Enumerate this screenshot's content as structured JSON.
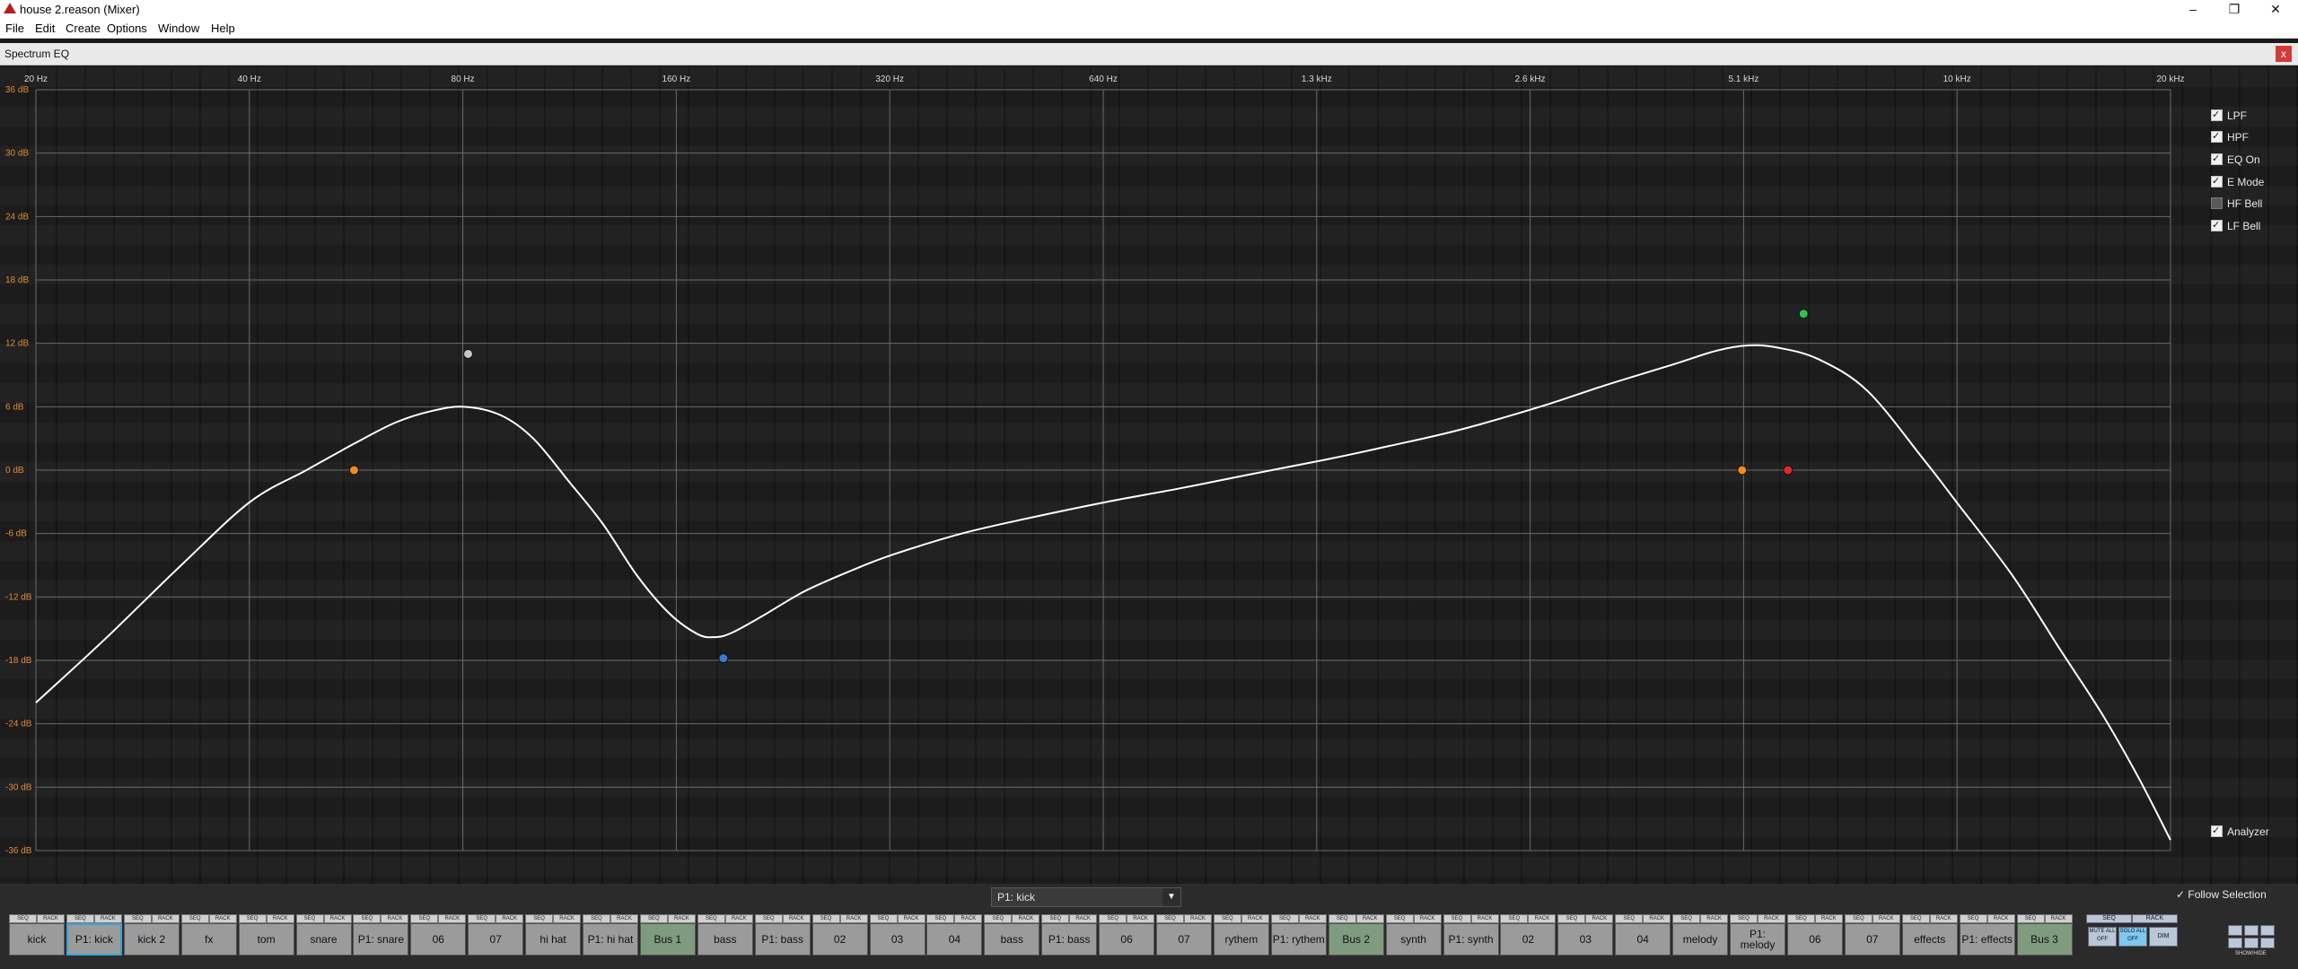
{
  "window": {
    "title": "house 2.reason (Mixer)"
  },
  "window_controls": {
    "minimize": "–",
    "restore": "❐",
    "close": "✕"
  },
  "menu": [
    "File",
    "Edit",
    "Create",
    "Options",
    "Window",
    "Help"
  ],
  "panel": {
    "title": "Spectrum EQ",
    "close_label": "x"
  },
  "freq_labels": [
    "20 Hz",
    "40 Hz",
    "80 Hz",
    "160 Hz",
    "320 Hz",
    "640 Hz",
    "1.3 kHz",
    "2.6 kHz",
    "5.1 kHz",
    "10 kHz",
    "20 kHz"
  ],
  "db_labels": [
    "36 dB",
    "30 dB",
    "24 dB",
    "18 dB",
    "12 dB",
    "6 dB",
    "0 dB",
    "-6 dB",
    "-12 dB",
    "-18 dB",
    "-24 dB",
    "-30 dB",
    "-36 dB"
  ],
  "options": [
    {
      "label": "LPF",
      "checked": true
    },
    {
      "label": "HPF",
      "checked": true
    },
    {
      "label": "EQ On",
      "checked": true
    },
    {
      "label": "E Mode",
      "checked": true
    },
    {
      "label": "HF Bell",
      "checked": false
    },
    {
      "label": "LF Bell",
      "checked": true
    }
  ],
  "analyzer": {
    "label": "Analyzer",
    "checked": true
  },
  "eq_curve": [
    [
      20,
      -22
    ],
    [
      25,
      -16
    ],
    [
      32,
      -9
    ],
    [
      40,
      -3
    ],
    [
      48,
      0
    ],
    [
      56,
      2.5
    ],
    [
      64,
      4.5
    ],
    [
      72,
      5.6
    ],
    [
      80,
      6
    ],
    [
      90,
      5.2
    ],
    [
      100,
      3
    ],
    [
      112,
      -1
    ],
    [
      125,
      -5
    ],
    [
      140,
      -10
    ],
    [
      155,
      -13.5
    ],
    [
      170,
      -15.5
    ],
    [
      180,
      -15.8
    ],
    [
      190,
      -15.4
    ],
    [
      210,
      -13.8
    ],
    [
      240,
      -11.5
    ],
    [
      280,
      -9.5
    ],
    [
      320,
      -8
    ],
    [
      400,
      -6
    ],
    [
      500,
      -4.5
    ],
    [
      640,
      -3
    ],
    [
      800,
      -1.8
    ],
    [
      1000,
      -0.5
    ],
    [
      1300,
      1
    ],
    [
      1600,
      2.3
    ],
    [
      2000,
      3.8
    ],
    [
      2600,
      6
    ],
    [
      3200,
      8
    ],
    [
      4000,
      10
    ],
    [
      4600,
      11.3
    ],
    [
      5100,
      11.8
    ],
    [
      5600,
      11.6
    ],
    [
      6400,
      10.5
    ],
    [
      7500,
      7.5
    ],
    [
      9000,
      1
    ],
    [
      10000,
      -3
    ],
    [
      12000,
      -10
    ],
    [
      14000,
      -17
    ],
    [
      16000,
      -23
    ],
    [
      18000,
      -29
    ],
    [
      20000,
      -35
    ]
  ],
  "eq_points": [
    {
      "freq": 56,
      "db": 0,
      "color": "#f08c1e"
    },
    {
      "freq": 81,
      "db": 11,
      "color": "#c8c8c8"
    },
    {
      "freq": 185,
      "db": -17.8,
      "color": "#3a78d8"
    },
    {
      "freq": 5000,
      "db": 0,
      "color": "#f08c1e"
    },
    {
      "freq": 5800,
      "db": 0,
      "color": "#e02828"
    },
    {
      "freq": 6100,
      "db": 14.8,
      "color": "#2ec44a"
    }
  ],
  "bottom": {
    "selected_channel": "P1: kick",
    "follow_selection": "Follow Selection",
    "seq_label": "SEQ",
    "rack_label": "RACK",
    "strips": [
      "kick",
      "P1: kick",
      "kick 2",
      "fx",
      "tom",
      "snare",
      "P1: snare",
      "06",
      "07",
      "hi hat",
      "P1: hi hat",
      "Bus 1",
      "bass",
      "P1: bass",
      "02",
      "03",
      "04",
      "bass",
      "P1: bass",
      "06",
      "07",
      "rythem",
      "P1: rythem",
      "Bus 2",
      "synth",
      "P1: synth",
      "02",
      "03",
      "04",
      "melody",
      "P1: melody",
      "06",
      "07",
      "effects",
      "P1: effects",
      "Bus 3"
    ],
    "mute_all": "MUTE ALL OFF",
    "solo_all": "SOLO ALL OFF",
    "dim": "DIM",
    "show_hide": "SHOW/HIDE"
  }
}
